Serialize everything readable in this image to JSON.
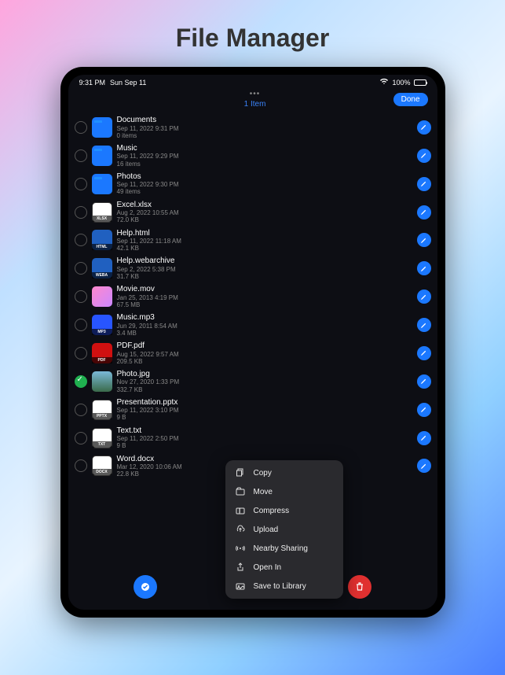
{
  "promo": {
    "title": "File Manager"
  },
  "status": {
    "time": "9:31 PM",
    "date": "Sun Sep 11",
    "battery": "100%"
  },
  "topbar": {
    "count_label": "1 Item",
    "done_label": "Done"
  },
  "files": [
    {
      "name": "Documents",
      "date": "Sep 11, 2022 9:31 PM",
      "size": "0 items",
      "type": "folder",
      "selected": false
    },
    {
      "name": "Music",
      "date": "Sep 11, 2022 9:29 PM",
      "size": "16 items",
      "type": "folder",
      "selected": false
    },
    {
      "name": "Photos",
      "date": "Sep 11, 2022 9:30 PM",
      "size": "49 items",
      "type": "folder",
      "selected": false
    },
    {
      "name": "Excel.xlsx",
      "date": "Aug 2, 2022 10:55 AM",
      "size": "72.0 KB",
      "type": "xlsx",
      "badge": "XLSX",
      "selected": false
    },
    {
      "name": "Help.html",
      "date": "Sep 11, 2022 11:18 AM",
      "size": "42.1 KB",
      "type": "html",
      "badge": "HTML",
      "selected": false
    },
    {
      "name": "Help.webarchive",
      "date": "Sep 2, 2022 5:38 PM",
      "size": "31.7 KB",
      "type": "weba",
      "badge": "WEBA",
      "selected": false
    },
    {
      "name": "Movie.mov",
      "date": "Jan 25, 2013 4:19 PM",
      "size": "67.5 MB",
      "type": "mov",
      "selected": false
    },
    {
      "name": "Music.mp3",
      "date": "Jun 29, 2011 8:54 AM",
      "size": "3.4 MB",
      "type": "mp3",
      "badge": "MP3",
      "selected": false
    },
    {
      "name": "PDF.pdf",
      "date": "Aug 15, 2022 9:57 AM",
      "size": "209.5 KB",
      "type": "pdf",
      "badge": "PDF",
      "selected": false
    },
    {
      "name": "Photo.jpg",
      "date": "Nov 27, 2020 1:33 PM",
      "size": "332.7 KB",
      "type": "jpg",
      "selected": true
    },
    {
      "name": "Presentation.pptx",
      "date": "Sep 11, 2022 3:10 PM",
      "size": "9 B",
      "type": "pptx",
      "badge": "PPTX",
      "selected": false
    },
    {
      "name": "Text.txt",
      "date": "Sep 11, 2022 2:50 PM",
      "size": "9 B",
      "type": "txt",
      "badge": "TXT",
      "selected": false
    },
    {
      "name": "Word.docx",
      "date": "Mar 12, 2020 10:06 AM",
      "size": "22.8 KB",
      "type": "docx",
      "badge": "DOCX",
      "selected": false
    }
  ],
  "context_menu": [
    {
      "icon": "copy",
      "label": "Copy"
    },
    {
      "icon": "move",
      "label": "Move"
    },
    {
      "icon": "compress",
      "label": "Compress"
    },
    {
      "icon": "upload",
      "label": "Upload"
    },
    {
      "icon": "nearby",
      "label": "Nearby Sharing"
    },
    {
      "icon": "openin",
      "label": "Open In"
    },
    {
      "icon": "save",
      "label": "Save to Library"
    }
  ]
}
